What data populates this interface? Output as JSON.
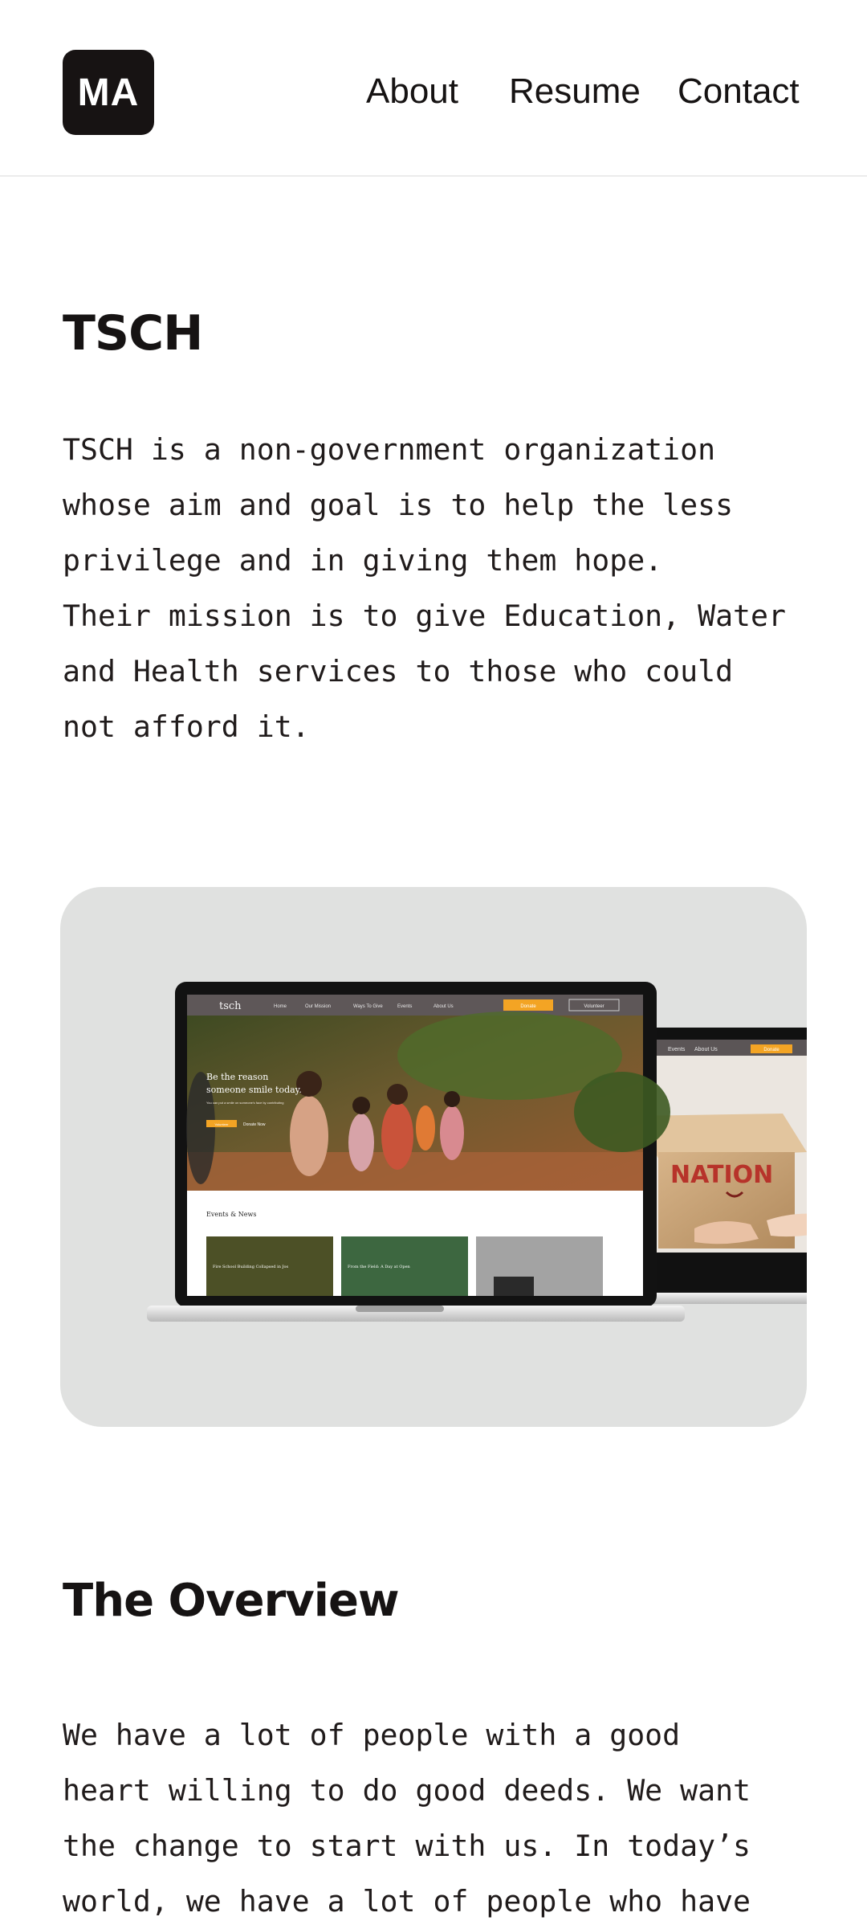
{
  "header": {
    "logo": "MA",
    "nav": [
      "About",
      "Resume",
      "Contact"
    ]
  },
  "project": {
    "title": "TSCH",
    "description": "TSCH is a non-government organization\nwhose aim and goal is to help the less\nprivilege and in giving them hope.\nTheir mission is to give Education, Water\nand Health services to those who could\nnot afford it."
  },
  "mockup": {
    "brand": "tsch",
    "menu": [
      "Home",
      "Our Mission",
      "Ways To Give",
      "Events",
      "About Us"
    ],
    "donate": "Donate",
    "volunteer": "Volunteer",
    "hero_line1": "Be the reason",
    "hero_line2": "someone smile today.",
    "hero_body": "You can put a smile on someone's face by contributing",
    "hero_btn1": "Volunteer",
    "hero_btn2": "Donate Now",
    "events_heading": "Events & News",
    "event1": "Fire School Building Collapsed in Jos",
    "event2": "From the Field: A Day at Open",
    "second_menu": [
      "Events",
      "About Us"
    ],
    "second_donate": "Donate",
    "box_text": "NATION",
    "accent": "#f3a424"
  },
  "overview": {
    "title": "The Overview",
    "text": "We have a lot of people with a good\nheart willing to do good deeds. We want\nthe change to start with us. In today’s\nworld, we have a lot of people who have"
  }
}
